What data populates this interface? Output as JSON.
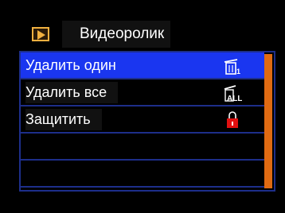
{
  "header": {
    "title": "Видеоролик",
    "icon": "video-play-icon"
  },
  "menu": {
    "items": [
      {
        "label": "Удалить один",
        "icon": "trash-one-icon",
        "selected": true
      },
      {
        "label": "Удалить все",
        "icon": "trash-all-icon",
        "selected": false
      },
      {
        "label": "Защитить",
        "icon": "lock-icon",
        "selected": false
      },
      {
        "label": "",
        "icon": "",
        "selected": false
      },
      {
        "label": "",
        "icon": "",
        "selected": false
      }
    ]
  },
  "colors": {
    "selection": "#1a36f0",
    "border": "#1d2e8a",
    "scrollbar": "#e06a12",
    "accent_icon": "#f0b040",
    "lock": "#e01010"
  },
  "icon_text": {
    "one": "1",
    "all": "ALL"
  }
}
